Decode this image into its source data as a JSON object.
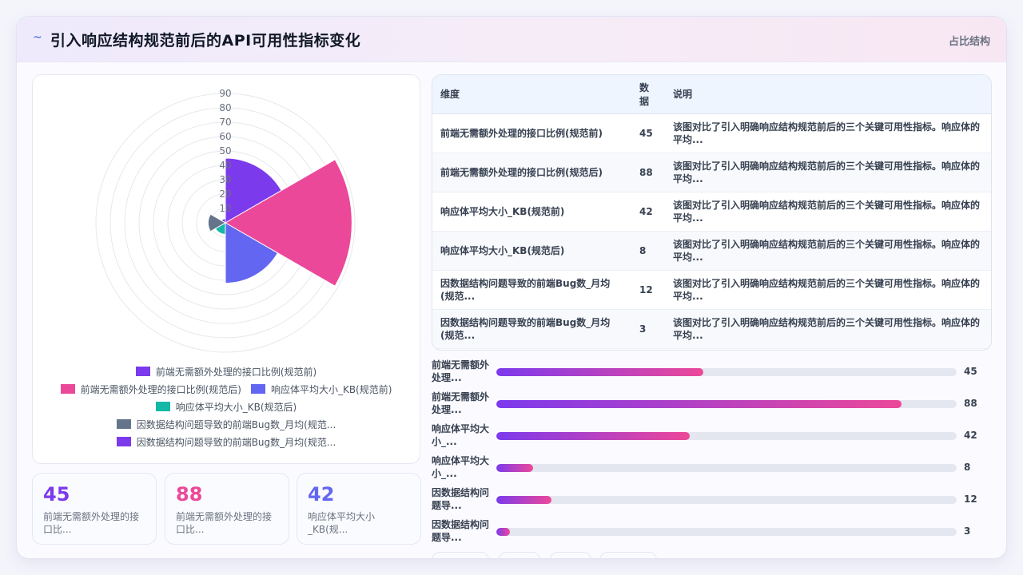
{
  "header": {
    "title": "引入响应结构规范前后的API可用性指标变化",
    "tag": "占比结构",
    "logo": "~"
  },
  "colors": [
    "#7c3aed",
    "#ec4899",
    "#6366f1",
    "#14b8a6",
    "#64748b",
    "#7c3aed"
  ],
  "chart_data": {
    "type": "polar-area",
    "title": "引入响应结构规范前后的API可用性指标变化",
    "radial_ticks": [
      10,
      20,
      30,
      40,
      50,
      60,
      70,
      80,
      90
    ],
    "rlim": [
      0,
      90
    ],
    "categories": [
      "前端无需额外处理的接口比例(规范前)",
      "前端无需额外处理的接口比例(规范后)",
      "响应体平均大小_KB(规范前)",
      "响应体平均大小_KB(规范后)",
      "因数据结构问题导致的前端Bug数_月均(规范前)",
      "因数据结构问题导致的前端Bug数_月均(规范后)"
    ],
    "values": [
      45,
      88,
      42,
      8,
      12,
      3
    ],
    "legend_position": "bottom"
  },
  "legend": [
    [
      "前端无需额外处理的接口比例(规范前)"
    ],
    [
      "前端无需额外处理的接口比例(规范后)",
      "响应体平均大小_KB(规范前)"
    ],
    [
      "响应体平均大小_KB(规范后)"
    ],
    [
      "因数据结构问题导致的前端Bug数_月均(规范..."
    ],
    [
      "因数据结构问题导致的前端Bug数_月均(规范..."
    ]
  ],
  "stats": [
    {
      "value": "45",
      "label": "前端无需额外处理的接口比...",
      "color": "#7c3aed"
    },
    {
      "value": "88",
      "label": "前端无需额外处理的接口比...",
      "color": "#ec4899"
    },
    {
      "value": "42",
      "label": "响应体平均大小_KB(规...",
      "color": "#6366f1"
    }
  ],
  "table": {
    "headers": [
      "维度",
      "数据",
      "说明"
    ],
    "rows": [
      [
        "前端无需额外处理的接口比例(规范前)",
        "45",
        "该图对比了引入明确响应结构规范前后的三个关键可用性指标。响应体的平均..."
      ],
      [
        "前端无需额外处理的接口比例(规范后)",
        "88",
        "该图对比了引入明确响应结构规范前后的三个关键可用性指标。响应体的平均..."
      ],
      [
        "响应体平均大小_KB(规范前)",
        "42",
        "该图对比了引入明确响应结构规范前后的三个关键可用性指标。响应体的平均..."
      ],
      [
        "响应体平均大小_KB(规范后)",
        "8",
        "该图对比了引入明确响应结构规范前后的三个关键可用性指标。响应体的平均..."
      ],
      [
        "因数据结构问题导致的前端Bug数_月均(规范...",
        "12",
        "该图对比了引入明确响应结构规范前后的三个关键可用性指标。响应体的平均..."
      ],
      [
        "因数据结构问题导致的前端Bug数_月均(规范...",
        "3",
        "该图对比了引入明确响应结构规范前后的三个关键可用性指标。响应体的平均..."
      ]
    ]
  },
  "bars": {
    "max": 100,
    "items": [
      {
        "label": "前端无需额外处理...",
        "value": "45"
      },
      {
        "label": "前端无需额外处理...",
        "value": "88"
      },
      {
        "label": "响应体平均大小_...",
        "value": "42"
      },
      {
        "label": "响应体平均大小_...",
        "value": "8"
      },
      {
        "label": "因数据结构问题导...",
        "value": "12"
      },
      {
        "label": "因数据结构问题导...",
        "value": "3"
      }
    ]
  }
}
